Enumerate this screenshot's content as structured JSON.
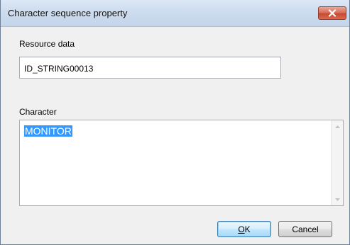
{
  "window": {
    "title": "Character sequence property",
    "close_icon": "close-icon"
  },
  "resource": {
    "label": "Resource data",
    "value": "ID_STRING00013"
  },
  "character": {
    "label": "Character",
    "value": "MONITOR",
    "selected": true
  },
  "buttons": {
    "ok": "OK",
    "cancel": "Cancel"
  },
  "colors": {
    "selection": "#3399ff",
    "close_button": "#c84a33",
    "default_button_border": "#3c7fb1"
  }
}
